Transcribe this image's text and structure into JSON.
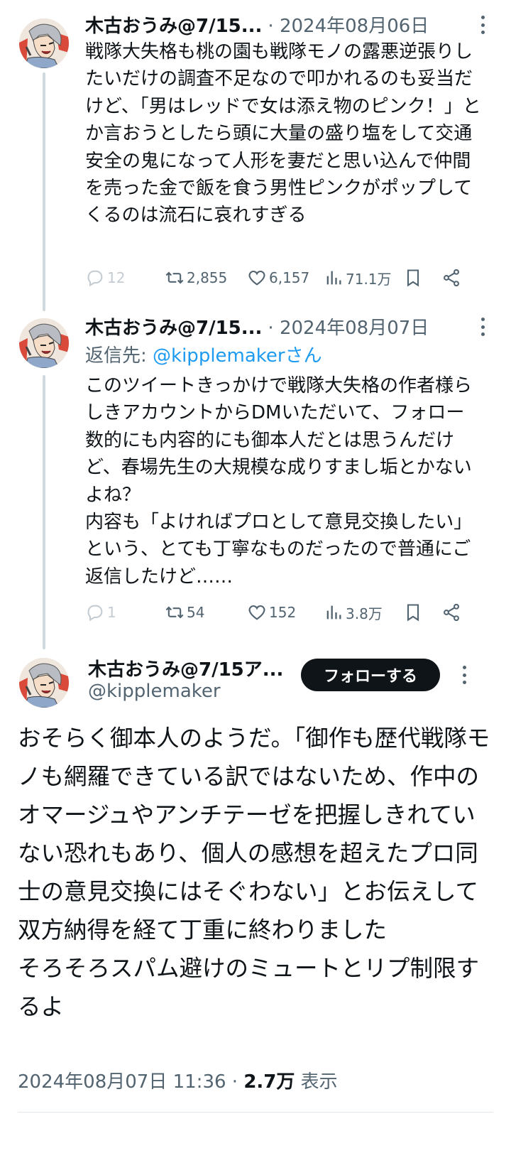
{
  "tweets": [
    {
      "author_name": "木古おうみ@7/15...",
      "date": "2024年08月06日",
      "text": "戦隊大失格も桃の園も戦隊モノの露悪逆張りしたいだけの調査不足なので叩かれるのも妥当だけど、「男はレッドで女は添え物のピンク！」とか言おうとしたら頭に大量の盛り塩をして交通安全の鬼になって人形を妻だと思い込んで仲間を売った金で飯を食う男性ピンクがポップしてくるのは流石に哀れすぎる",
      "replies": "12",
      "retweets": "2,855",
      "likes": "6,157",
      "views": "71.1万"
    },
    {
      "author_name": "木古おうみ@7/15...",
      "date": "2024年08月07日",
      "reply_label": "返信先: ",
      "reply_handle": "@kipplemakerさん",
      "text": "このツイートきっかけで戦隊大失格の作者様らしきアカウントからDMいただいて、フォロー数的にも内容的にも御本人だとは思うんだけど、春場先生の大規模な成りすまし垢とかないよね？\n内容も「よければプロとして意見交換したい」という、とても丁寧なものだったので普通にご返信したけど……",
      "replies": "1",
      "retweets": "54",
      "likes": "152",
      "views": "3.8万"
    }
  ],
  "main_tweet": {
    "author_name": "木古おうみ@7/15ア...",
    "handle": "@kipplemaker",
    "follow_label": "フォローする",
    "text": "おそらく御本人のようだ。「御作も歴代戦隊モノも網羅できている訳ではないため、作中のオマージュやアンチテーゼを把握しきれていない恐れもあり、個人の感想を超えたプロ同士の意見交換にはそぐわない」とお伝えして双方納得を経て丁重に終わりました\nそろそろスパム避けのミュートとリプ制限するよ",
    "timestamp": "2024年08月07日 11:36",
    "separator": " · ",
    "views": "2.7万",
    "views_label": " 表示"
  },
  "date_separator": "·",
  "icons": [
    "reply-icon",
    "retweet-icon",
    "like-icon",
    "views-icon",
    "bookmark-icon",
    "share-icon",
    "more-icon"
  ],
  "colors": {
    "text": "#0f1419",
    "muted": "#536471",
    "link": "#1d9bf0",
    "line": "#cfd9de",
    "button": "#0f1419"
  }
}
